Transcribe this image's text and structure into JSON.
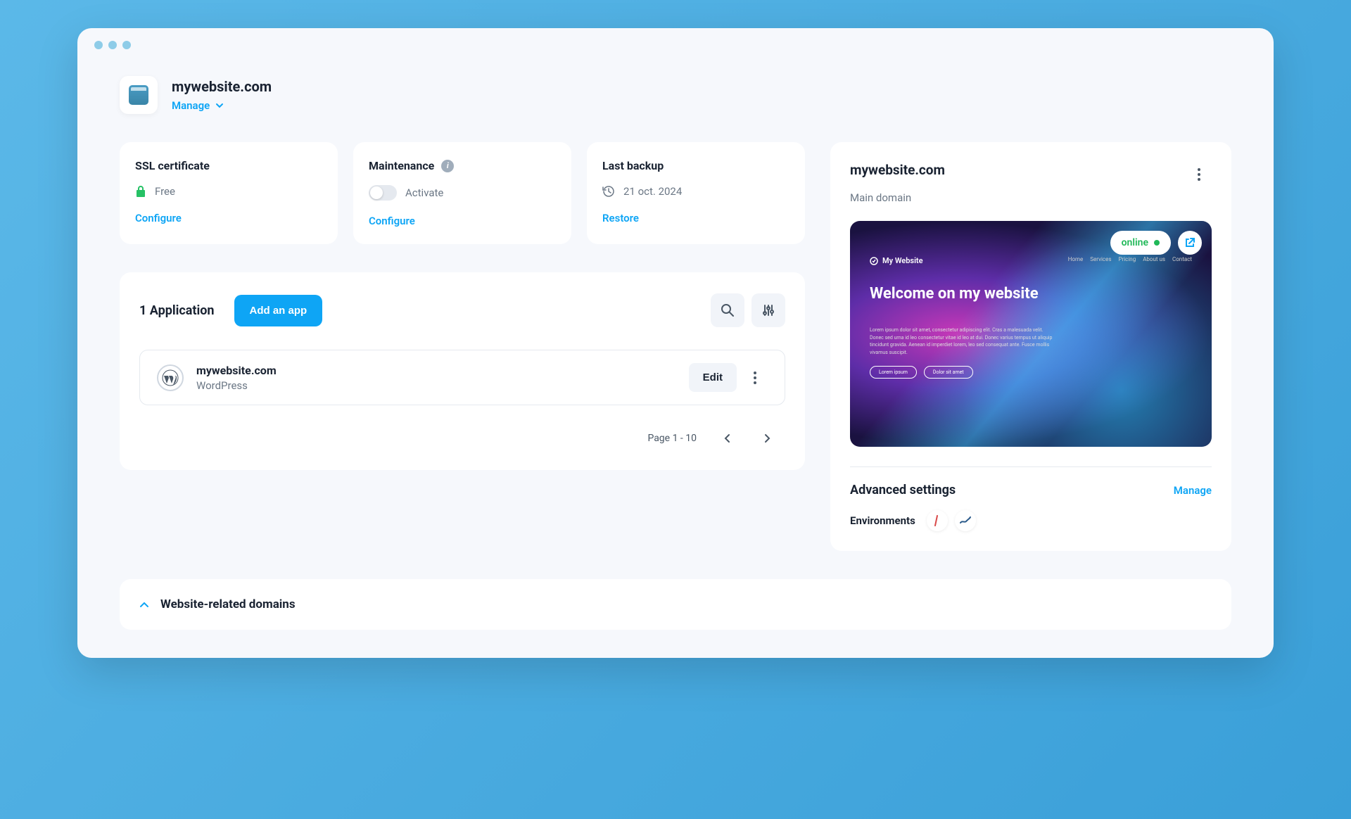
{
  "header": {
    "site_name": "mywebsite.com",
    "manage_label": "Manage"
  },
  "status": {
    "ssl": {
      "title": "SSL certificate",
      "value": "Free",
      "action": "Configure"
    },
    "maintenance": {
      "title": "Maintenance",
      "value": "Activate",
      "action": "Configure"
    },
    "backup": {
      "title": "Last backup",
      "value": "21 oct. 2024",
      "action": "Restore"
    }
  },
  "apps": {
    "count_label": "1 Application",
    "add_button": "Add an app",
    "items": [
      {
        "name": "mywebsite.com",
        "type": "WordPress",
        "edit_label": "Edit"
      }
    ],
    "pagination": "Page 1 - 10"
  },
  "preview": {
    "domain": "mywebsite.com",
    "subtitle": "Main domain",
    "status_badge": "online",
    "site_title": "My Website",
    "headline": "Welcome on my website",
    "nav": [
      "Home",
      "Services",
      "Pricing",
      "About us",
      "Contact"
    ],
    "btn1": "Lorem ipsum",
    "btn2": "Dolor sit amet"
  },
  "advanced": {
    "title": "Advanced settings",
    "manage_label": "Manage",
    "environments_label": "Environments"
  },
  "domains": {
    "title": "Website-related domains"
  }
}
